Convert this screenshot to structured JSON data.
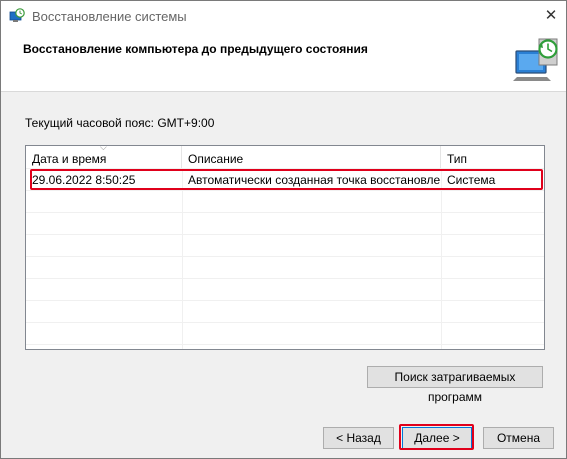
{
  "window": {
    "title": "Восстановление системы",
    "close_glyph": "✕",
    "title_icon": "system-restore-icon"
  },
  "header": {
    "title": "Восстановление компьютера до предыдущего состояния",
    "icon": "system-restore-monitor-icon"
  },
  "timezone_text": "Текущий часовой пояс: GMT+9:00",
  "table": {
    "columns": [
      "Дата и время",
      "Описание",
      "Тип"
    ],
    "rows": [
      {
        "date": "29.06.2022 8:50:25",
        "description": "Автоматически созданная точка восстановле...",
        "type": "Система"
      }
    ]
  },
  "buttons": {
    "scan": "Поиск затрагиваемых программ",
    "back": "< Назад",
    "next": "Далее >",
    "cancel": "Отмена"
  },
  "colors": {
    "highlight": "#e0001b",
    "accent": "#0078d7"
  }
}
